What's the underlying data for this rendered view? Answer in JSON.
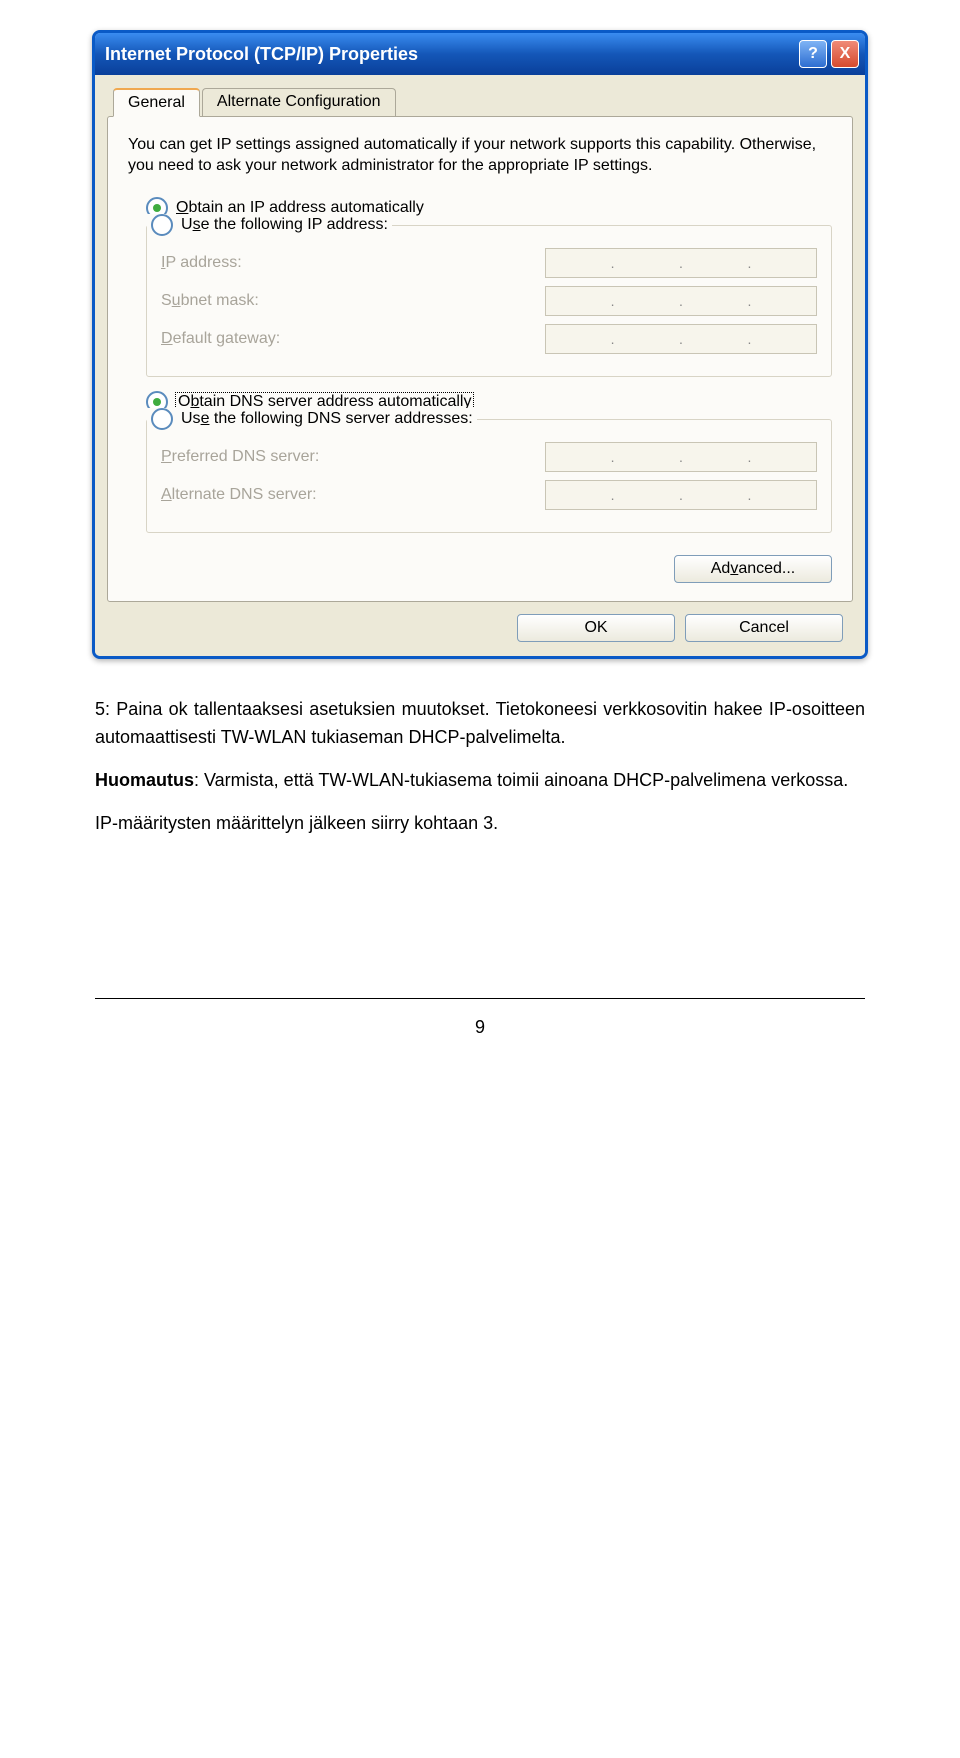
{
  "dialog": {
    "title": "Internet Protocol (TCP/IP) Properties",
    "help_icon": "?",
    "close_icon": "X",
    "tabs": {
      "general": "General",
      "alternate": "Alternate Configuration"
    },
    "intro": "You can get IP settings assigned automatically if your network supports this capability. Otherwise, you need to ask your network administrator for the appropriate IP settings.",
    "ip_group": {
      "obtain": "Obtain an IP address automatically",
      "use": "Use the following IP address:",
      "ip_label": "IP address:",
      "subnet_label": "Subnet mask:",
      "gateway_label": "Default gateway:"
    },
    "dns_group": {
      "obtain": "Obtain DNS server address automatically",
      "use": "Use the following DNS server addresses:",
      "preferred_label": "Preferred DNS server:",
      "alternate_label": "Alternate DNS server:"
    },
    "advanced_button": "Advanced...",
    "ok_button": "OK",
    "cancel_button": "Cancel"
  },
  "doc": {
    "p1": "5: Paina ok tallentaaksesi asetuksien muutokset. Tietokoneesi verkkosovitin hakee IP-osoitteen automaattisesti TW-WLAN tukiaseman DHCP-palvelimelta.",
    "p2_bold": "Huomautus",
    "p2_rest": ": Varmista, että TW-WLAN-tukiasema toimii ainoana DHCP-palvelimena verkossa.",
    "p3": "IP-määritysten määrittelyn jälkeen siirry kohtaan 3.",
    "page_number": "9"
  }
}
